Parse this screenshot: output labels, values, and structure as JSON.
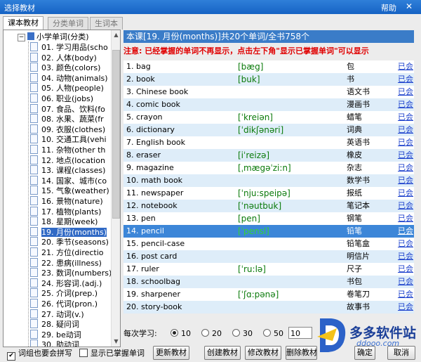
{
  "window": {
    "title": "选择教材",
    "help": "帮助",
    "close": "✕"
  },
  "tabs": [
    "课本教材",
    "分类单词",
    "生词本"
  ],
  "tree": {
    "root": "小学单词(分类)",
    "items": [
      "01. 学习用品(scho",
      "02. 人体(body)",
      "03. 颜色(colors)",
      "04. 动物(animals)",
      "05. 人物(people)",
      "06. 职业(jobs)",
      "07. 食品、饮料(fo",
      "08. 水果、蔬菜(fr",
      "09. 衣服(clothes)",
      "10. 交通工具(vehi",
      "11. 杂物(other th",
      "12. 地点(location",
      "13. 课程(classes)",
      "14. 国家、城市(co",
      "15. 气象(weather)",
      "16. 景物(nature)",
      "17. 植物(plants)",
      "18. 星期(week)",
      "19. 月份(months)",
      "20. 季节(seasons)",
      "21. 方位(directio",
      "22. 患病(illness)",
      "23. 数词(numbers)",
      "24. 形容词.(adj.)",
      "25. 介词(prep.)",
      "26. 代词(pron.)",
      "27. 动词(v.)",
      "28. 疑问词",
      "29. be动词",
      "30. 助动词"
    ],
    "selected_index": 18
  },
  "header": "本课[19. 月份(months)]共20个单词/全书758个",
  "notice": "注意: 已经掌握的单词不再显示，点击左下角\"显示已掌握单词\"可以显示",
  "words": [
    {
      "word": "1. bag",
      "phonetic": "[bæg]",
      "meaning": "包",
      "action": "已会"
    },
    {
      "word": "2. book",
      "phonetic": "[buk]",
      "meaning": "书",
      "action": "已会"
    },
    {
      "word": "3. Chinese book",
      "phonetic": "",
      "meaning": "语文书",
      "action": "已会"
    },
    {
      "word": "4. comic book",
      "phonetic": "",
      "meaning": "漫画书",
      "action": "已会"
    },
    {
      "word": "5. crayon",
      "phonetic": "[ˈkreiən]",
      "meaning": "蜡笔",
      "action": "已会"
    },
    {
      "word": "6. dictionary",
      "phonetic": "[ˈdikʃənəri]",
      "meaning": "词典",
      "action": "已会"
    },
    {
      "word": "7. English book",
      "phonetic": "",
      "meaning": "英语书",
      "action": "已会"
    },
    {
      "word": "8. eraser",
      "phonetic": "[iˈreizə]",
      "meaning": "橡皮",
      "action": "已会"
    },
    {
      "word": "9. magazine",
      "phonetic": "[ˌmægəˈzi:n]",
      "meaning": "杂志",
      "action": "已会"
    },
    {
      "word": "10. math book",
      "phonetic": "",
      "meaning": "数学书",
      "action": "已会"
    },
    {
      "word": "11. newspaper",
      "phonetic": "[ˈnju:speipə]",
      "meaning": "报纸",
      "action": "已会"
    },
    {
      "word": "12. notebook",
      "phonetic": "[ˈnəutbuk]",
      "meaning": "笔记本",
      "action": "已会"
    },
    {
      "word": "13. pen",
      "phonetic": "[pen]",
      "meaning": "钢笔",
      "action": "已会"
    },
    {
      "word": "14. pencil",
      "phonetic": "[ˈpensl]",
      "meaning": "铅笔",
      "action": "已会"
    },
    {
      "word": "15. pencil-case",
      "phonetic": "",
      "meaning": "铅笔盒",
      "action": "已会"
    },
    {
      "word": "16. post card",
      "phonetic": "",
      "meaning": "明信片",
      "action": "已会"
    },
    {
      "word": "17. ruler",
      "phonetic": "[ˈru:lə]",
      "meaning": "尺子",
      "action": "已会"
    },
    {
      "word": "18. schoolbag",
      "phonetic": "",
      "meaning": "书包",
      "action": "已会"
    },
    {
      "word": "19. sharpener",
      "phonetic": "[ˈʃɑ:pənə]",
      "meaning": "卷笔刀",
      "action": "已会"
    },
    {
      "word": "20. story-book",
      "phonetic": "",
      "meaning": "故事书",
      "action": "已会"
    }
  ],
  "selected_word_index": 13,
  "per_study": {
    "label": "每次学习:",
    "options": [
      "10",
      "20",
      "30",
      "50"
    ],
    "selected": "10",
    "custom_value": "10"
  },
  "checkboxes": {
    "group_spell": {
      "label": "词组也要会拼写",
      "checked": true
    },
    "show_mastered": {
      "label": "显示已掌握单词",
      "checked": false
    }
  },
  "buttons": {
    "update": "更新教材",
    "create": "创建教材",
    "modify": "修改教材",
    "delete": "删除教材",
    "ok": "确定",
    "cancel": "取消"
  },
  "watermark": {
    "text": "多多软件站",
    "url": "ddooo.com"
  },
  "colors": {
    "titlebar": "#1663c4",
    "header": "#3a7cc8",
    "selected_row": "#3c86d8",
    "alt_row": "#deedf9",
    "notice": "#e00000",
    "phonetic": "#0a7a0a"
  }
}
